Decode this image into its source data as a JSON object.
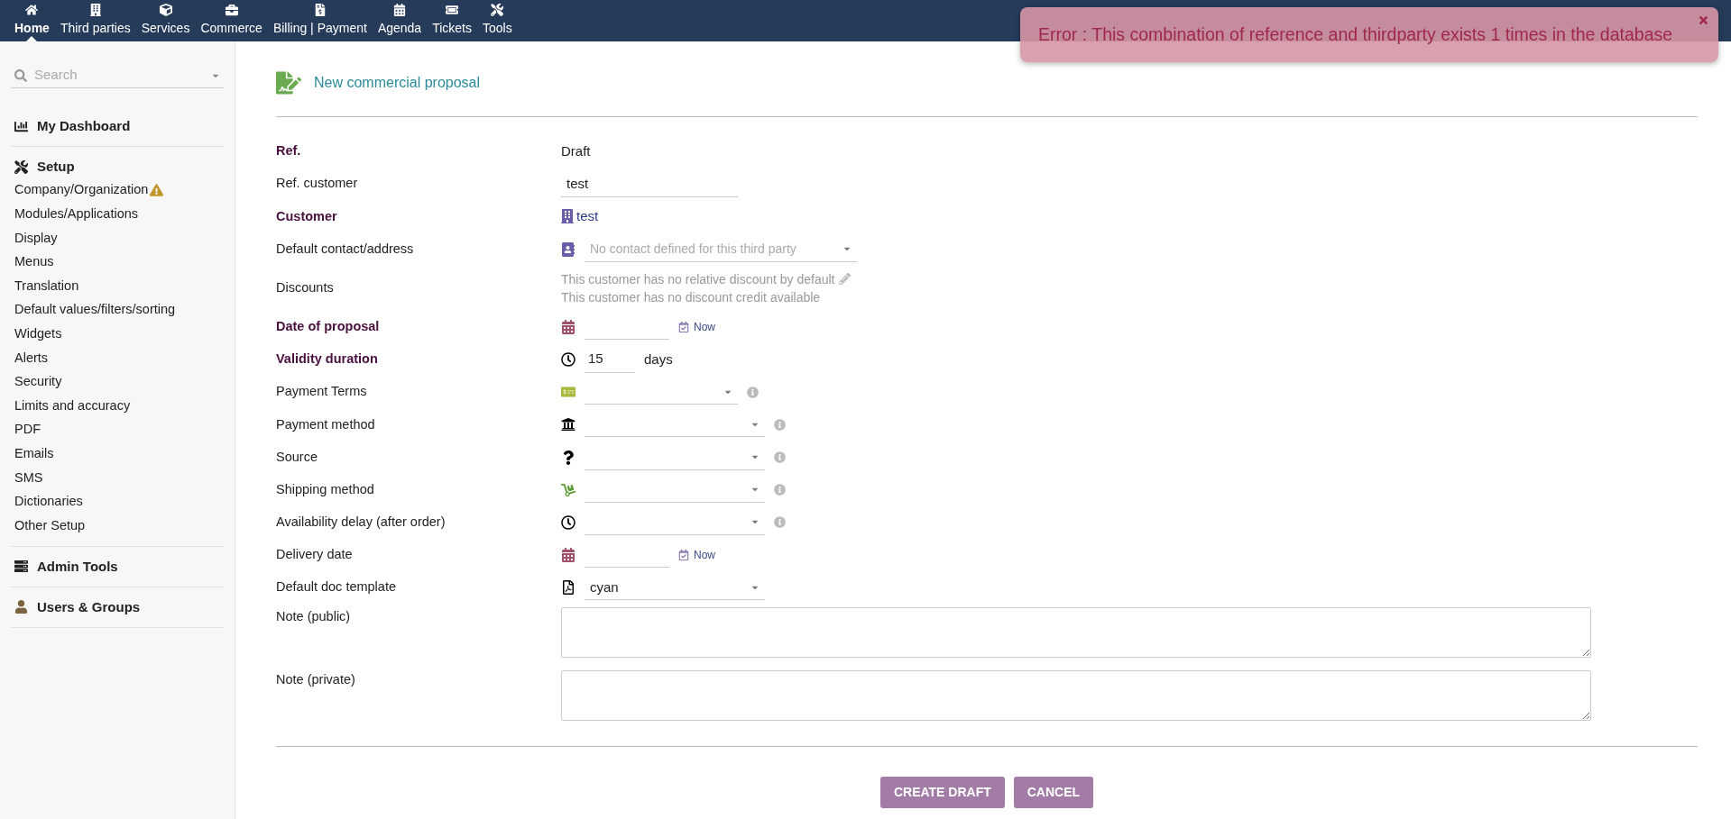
{
  "nav": [
    {
      "label": "Home",
      "selected": true
    },
    {
      "label": "Third parties",
      "selected": false
    },
    {
      "label": "Services",
      "selected": false
    },
    {
      "label": "Commerce",
      "selected": false
    },
    {
      "label": "Billing | Payment",
      "selected": false
    },
    {
      "label": "Agenda",
      "selected": false
    },
    {
      "label": "Tickets",
      "selected": false
    },
    {
      "label": "Tools",
      "selected": false
    }
  ],
  "sidebar": {
    "search": {
      "placeholder": "Search"
    },
    "sections": [
      {
        "title": "My Dashboard"
      },
      {
        "title": "Setup",
        "items": [
          {
            "label": "Company/Organization",
            "warning": true
          },
          {
            "label": "Modules/Applications",
            "warning": false
          },
          {
            "label": "Display",
            "warning": false
          },
          {
            "label": "Menus",
            "warning": false
          },
          {
            "label": "Translation",
            "warning": false
          },
          {
            "label": "Default values/filters/sorting",
            "warning": false
          },
          {
            "label": "Widgets",
            "warning": false
          },
          {
            "label": "Alerts",
            "warning": false
          },
          {
            "label": "Security",
            "warning": false
          },
          {
            "label": "Limits and accuracy",
            "warning": false
          },
          {
            "label": "PDF",
            "warning": false
          },
          {
            "label": "Emails",
            "warning": false
          },
          {
            "label": "SMS",
            "warning": false
          },
          {
            "label": "Dictionaries",
            "warning": false
          },
          {
            "label": "Other Setup",
            "warning": false
          }
        ]
      },
      {
        "title": "Admin Tools"
      },
      {
        "title": "Users & Groups"
      }
    ]
  },
  "page": {
    "title": "New commercial proposal"
  },
  "form": [
    {
      "label": "Ref.",
      "bold": true,
      "kind": "text",
      "value": "Draft"
    },
    {
      "label": "Ref. customer",
      "bold": false,
      "kind": "input",
      "value": "test"
    },
    {
      "label": "Customer",
      "bold": true,
      "kind": "link",
      "value": "test"
    },
    {
      "label": "Default contact/address",
      "bold": false,
      "kind": "select",
      "placeholder": "No contact defined for this third party",
      "info": false
    },
    {
      "label": "Discounts",
      "bold": false,
      "kind": "discounts",
      "lines": [
        "This customer has no relative discount by default",
        "This customer has no discount credit available"
      ]
    },
    {
      "label": "Date of proposal",
      "bold": true,
      "kind": "date",
      "now": "Now"
    },
    {
      "label": "Validity duration",
      "bold": true,
      "kind": "duration",
      "value": "15",
      "unit": "days"
    },
    {
      "label": "Payment Terms",
      "bold": false,
      "kind": "select",
      "info": true
    },
    {
      "label": "Payment method",
      "bold": false,
      "kind": "select",
      "info": true
    },
    {
      "label": "Source",
      "bold": false,
      "kind": "select",
      "info": true
    },
    {
      "label": "Shipping method",
      "bold": false,
      "kind": "select",
      "info": true
    },
    {
      "label": "Availability delay (after order)",
      "bold": false,
      "kind": "select",
      "info": true
    },
    {
      "label": "Delivery date",
      "bold": false,
      "kind": "date",
      "now": "Now"
    },
    {
      "label": "Default doc template",
      "bold": false,
      "kind": "select",
      "value": "cyan",
      "info": false
    },
    {
      "label": "Note (public)",
      "bold": false,
      "kind": "textarea"
    },
    {
      "label": "Note (private)",
      "bold": false,
      "kind": "textarea"
    }
  ],
  "buttons": [
    "CREATE DRAFT",
    "CANCEL"
  ],
  "error": {
    "text": "Error : This combination of reference and thirdparty exists 1 times in the database"
  }
}
